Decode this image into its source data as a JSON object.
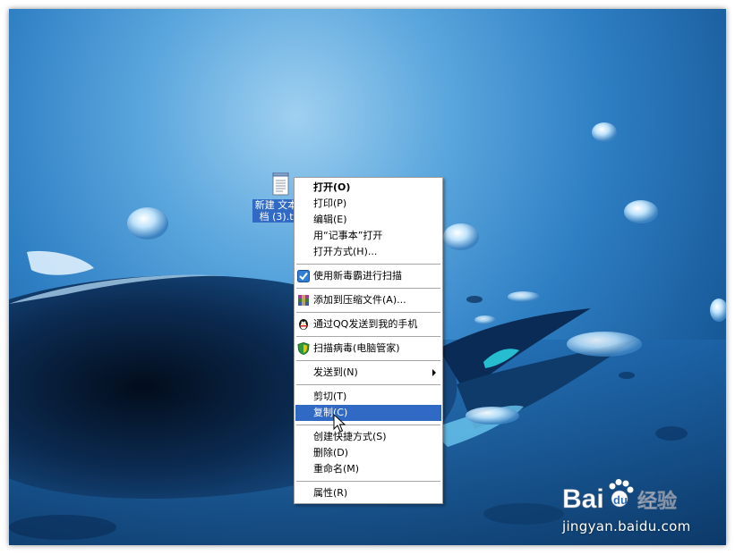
{
  "desktop": {
    "file_icon": {
      "label": "新建 文本文档 (3).txt"
    }
  },
  "context_menu": {
    "items": [
      {
        "label": "打开(O)",
        "bold": true
      },
      {
        "label": "打印(P)"
      },
      {
        "label": "编辑(E)"
      },
      {
        "label": "用“记事本”打开"
      },
      {
        "label": "打开方式(H)..."
      },
      {
        "label": "使用新毒霸进行扫描",
        "icon": "duba-shield-icon"
      },
      {
        "label": "添加到压缩文件(A)...",
        "icon": "winrar-icon"
      },
      {
        "label": "通过QQ发送到我的手机",
        "icon": "qq-penguin-icon"
      },
      {
        "label": "扫描病毒(电脑管家)",
        "icon": "tencent-guard-icon"
      },
      {
        "label": "发送到(N)",
        "submenu": true
      },
      {
        "label": "剪切(T)"
      },
      {
        "label": "复制(C)",
        "selected": true
      },
      {
        "label": "创建快捷方式(S)"
      },
      {
        "label": "删除(D)"
      },
      {
        "label": "重命名(M)"
      },
      {
        "label": "属性(R)"
      }
    ]
  },
  "watermark": {
    "brand": "Bai",
    "brand2": "du",
    "suffix": "经验",
    "url": "jingyan.baidu.com"
  },
  "colors": {
    "selection": "#316ac5",
    "menu_bg": "#ffffff",
    "menu_border": "#a0a0a0",
    "desktop_blue": "#2f7fc4"
  }
}
